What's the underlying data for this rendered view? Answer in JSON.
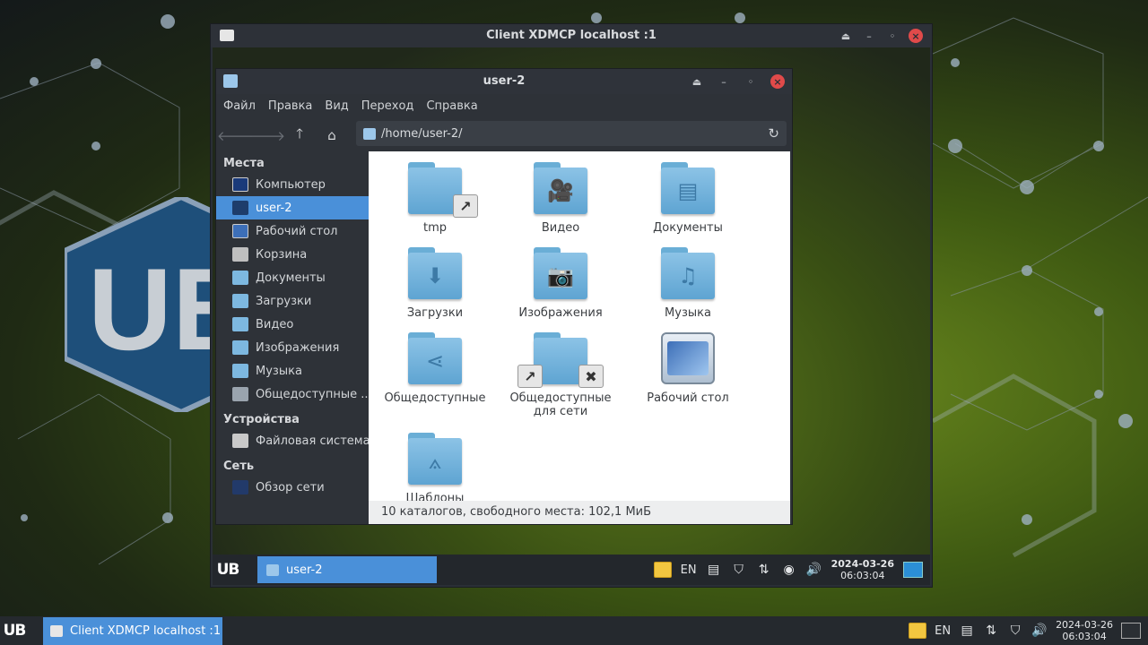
{
  "outer_window": {
    "title": "Client XDMCP localhost  :1"
  },
  "file_manager": {
    "title": "user-2",
    "menu": [
      "Файл",
      "Правка",
      "Вид",
      "Переход",
      "Справка"
    ],
    "path": "/home/user-2/",
    "sidebar": {
      "places_header": "Места",
      "places": [
        "Компьютер",
        "user-2",
        "Рабочий стол",
        "Корзина",
        "Документы",
        "Загрузки",
        "Видео",
        "Изображения",
        "Музыка",
        "Общедоступные ..."
      ],
      "devices_header": "Устройства",
      "devices": [
        "Файловая система"
      ],
      "network_header": "Сеть",
      "network": [
        "Обзор сети"
      ]
    },
    "items": [
      "tmp",
      "Видео",
      "Документы",
      "Загрузки",
      "Изображения",
      "Музыка",
      "Общедоступные",
      "Общедоступные для сети",
      "Рабочий стол",
      "Шаблоны"
    ],
    "status": "10 каталогов, свободного места: 102,1 МиБ"
  },
  "inner_taskbar": {
    "logo": "UB",
    "window_button": "user-2",
    "lang": "EN",
    "date": "2024-03-26",
    "time": "06:03:04"
  },
  "outer_taskbar": {
    "logo": "UB",
    "window_button": "Client XDMCP localhost  :1",
    "lang": "EN",
    "date": "2024-03-26",
    "time": "06:03:04"
  },
  "colors": {
    "accent": "#4a90d9",
    "close": "#e04a4a",
    "folder": "#6aaed6"
  }
}
